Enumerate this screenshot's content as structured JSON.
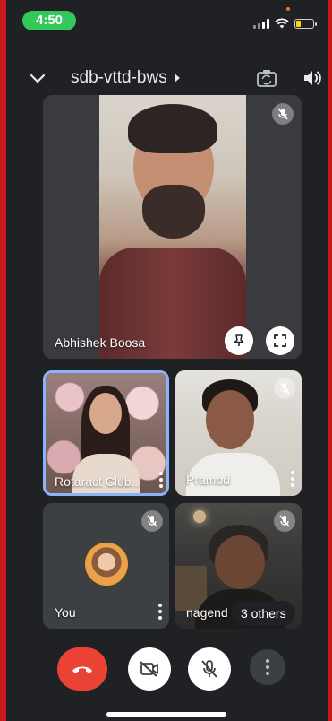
{
  "status_bar": {
    "time": "4:50",
    "icons": [
      "signal-icon",
      "wifi-icon",
      "battery-icon"
    ],
    "accent_time": "#34c759",
    "battery_color": "#ffd60a"
  },
  "header": {
    "meeting_code": "sdb-vttd-bws",
    "icons": [
      "chevron-down-icon",
      "flip-camera-icon",
      "speaker-icon"
    ]
  },
  "tiles": {
    "main": {
      "name": "Abhishek Boosa",
      "muted": true
    },
    "rotaract": {
      "name": "Rotaract Club...",
      "active_speaker": true,
      "highlight_color": "#8ab4f8"
    },
    "pramod": {
      "name": "Pramod",
      "muted": true
    },
    "you": {
      "name": "You",
      "muted": true
    },
    "nagend": {
      "name": "nagend",
      "others": "3 others",
      "muted": true
    }
  },
  "controls": {
    "end_call_color": "#ea4335",
    "items": [
      "end-call-icon",
      "camera-off-icon",
      "mic-off-icon",
      "more-options-icon"
    ]
  }
}
